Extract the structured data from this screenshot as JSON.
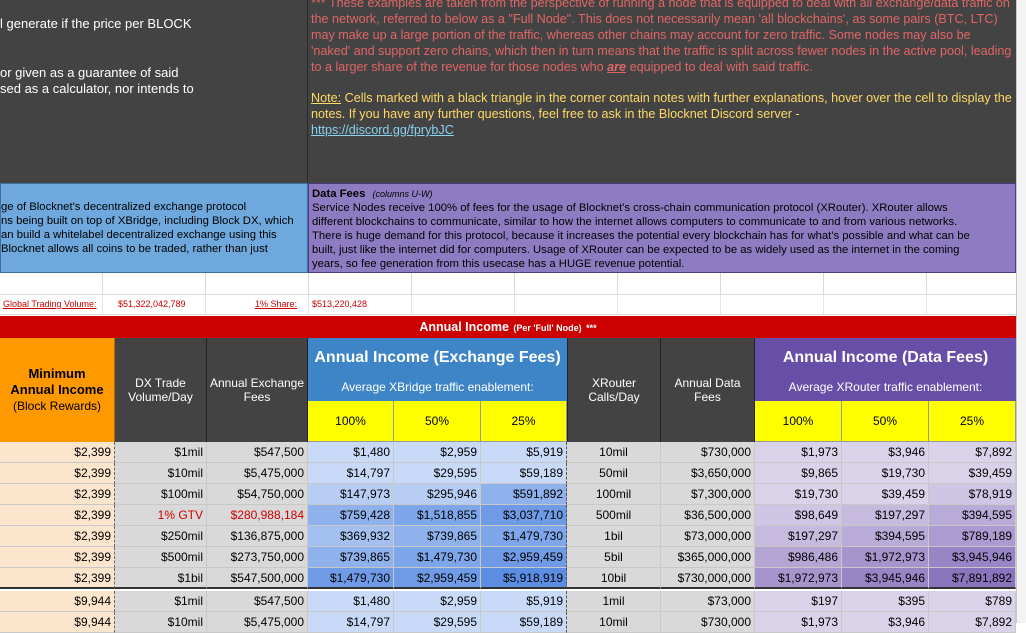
{
  "top_left": {
    "line1": "l generate if the price per BLOCK",
    "line2": "or given as a guarantee of said",
    "line3": "sed as a calculator, nor intends to"
  },
  "top_right": {
    "notice": "*** These examples are taken from the perspective of running a node that is equipped to deal with all exchange/data traffic on the network, referred to below as a \"Full Node\". This does not necessarily mean 'all blockchains', as some pairs (BTC, LTC) may make up a large portion of the traffic, whereas other chains may account for zero traffic. Some nodes may also be 'naked' and support zero chains, which then in turn means that the traffic is split across fewer nodes in the active pool, leading to a larger share of the revenue for those nodes who",
    "notice_emph": "are",
    "notice_tail": "equipped to deal with said traffic.",
    "note_label": "Note:",
    "note_text": "Cells marked with a black triangle in the corner contain notes with further explanations, hover over the cell to display the notes. If you have any further questions, feel free to ask in the Blocknet Discord server -",
    "discord_link": "https://discord.gg/fprybJC"
  },
  "dex_fees": {
    "line1": "ge of Blocknet's decentralized exchange protocol",
    "line2": "ns being built on top of XBridge, including Block DX, which",
    "line3": "an build a whitelabel decentralized exchange using this",
    "line4": "Blocknet allows all coins to be traded, rather than just"
  },
  "data_fees": {
    "title": "Data Fees",
    "columns": "(columns U-W)",
    "line1": "Service Nodes receive 100% of fees for the usage of Blocknet's cross-chain communication protocol (XRouter). XRouter allows",
    "line2": "different blockchains to communicate, similar to how the internet allows computers to communicate to and from various networks.",
    "line3": "There is huge demand for this protocol, because it increases the potential every blockchain has for what's possible and what can be",
    "line4": "built, just like the internet did for computers. Usage of XRouter can be expected to be as widely used as the internet in the coming",
    "line5": "years, so fee generation from this usecase has a HUGE revenue potential."
  },
  "volume_row": {
    "gtv_label": "Global Trading Volume:",
    "gtv_value": "$51,322,042,789",
    "share_label": "1% Share:",
    "share_value": "$513,220,428"
  },
  "banner": {
    "title": "Annual Income",
    "sub": "(Per 'Full' Node)",
    "stars": "***"
  },
  "headers": {
    "min_income": [
      "Minimum",
      "Annual Income"
    ],
    "min_income_sub": "(Block Rewards)",
    "dx_volume": [
      "DX Trade",
      "Volume/Day"
    ],
    "annual_exchange": [
      "Annual Exchange",
      "Fees"
    ],
    "exchange_group": "Annual Income (Exchange Fees)",
    "exchange_sub": "Average XBridge traffic enablement:",
    "xrouter_calls": [
      "XRouter",
      "Calls/Day"
    ],
    "annual_data": [
      "Annual Data",
      "Fees"
    ],
    "data_group": "Annual Income (Data Fees)",
    "data_sub": "Average XRouter traffic enablement:",
    "pct": [
      "100%",
      "50%",
      "25%"
    ]
  },
  "rows": [
    [
      "$2,399",
      "$1mil",
      "$547,500",
      "$1,480",
      "$2,959",
      "$5,919",
      "10mil",
      "$730,000",
      "$1,973",
      "$3,946",
      "$7,892"
    ],
    [
      "$2,399",
      "$10mil",
      "$5,475,000",
      "$14,797",
      "$29,595",
      "$59,189",
      "50mil",
      "$3,650,000",
      "$9,865",
      "$19,730",
      "$39,459"
    ],
    [
      "$2,399",
      "$100mil",
      "$54,750,000",
      "$147,973",
      "$295,946",
      "$591,892",
      "100mil",
      "$7,300,000",
      "$19,730",
      "$39,459",
      "$78,919"
    ],
    [
      "$2,399",
      "1% GTV",
      "$280,988,184",
      "$759,428",
      "$1,518,855",
      "$3,037,710",
      "500mil",
      "$36,500,000",
      "$98,649",
      "$197,297",
      "$394,595"
    ],
    [
      "$2,399",
      "$250mil",
      "$136,875,000",
      "$369,932",
      "$739,865",
      "$1,479,730",
      "1bil",
      "$73,000,000",
      "$197,297",
      "$394,595",
      "$789,189"
    ],
    [
      "$2,399",
      "$500mil",
      "$273,750,000",
      "$739,865",
      "$1,479,730",
      "$2,959,459",
      "5bil",
      "$365,000,000",
      "$986,486",
      "$1,972,973",
      "$3,945,946"
    ],
    [
      "$2,399",
      "$1bil",
      "$547,500,000",
      "$1,479,730",
      "$2,959,459",
      "$5,918,919",
      "10bil",
      "$730,000,000",
      "$1,972,973",
      "$3,945,946",
      "$7,891,892"
    ],
    [
      "$9,944",
      "$1mil",
      "$547,500",
      "$1,480",
      "$2,959",
      "$5,919",
      "1mil",
      "$73,000",
      "$197",
      "$395",
      "$789"
    ],
    [
      "$9,944",
      "$10mil",
      "$5,475,000",
      "$14,797",
      "$29,595",
      "$59,189",
      "10mil",
      "$730,000",
      "$1,973",
      "$3,946",
      "$7,892"
    ]
  ],
  "colors": {
    "dark": "#434343",
    "red_banner": "#cc0000",
    "orange": "#ff9900",
    "peach": "#fce5cd",
    "exchange_blue": "#3d85c6",
    "data_purple": "#674ea7",
    "yellow": "#ffff00",
    "dex_box": "#6fa8dc",
    "data_box": "#8e7cc3"
  }
}
